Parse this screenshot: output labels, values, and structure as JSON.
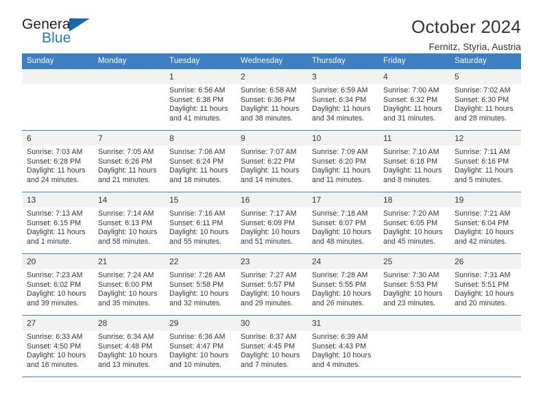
{
  "brand": {
    "word_one": "General",
    "word_two": "Blue",
    "flag_icon": "triangle-flag-icon"
  },
  "header": {
    "title": "October 2024",
    "location": "Fernitz, Styria, Austria"
  },
  "colors": {
    "header_blue": "#3d7fc1",
    "brand_blue": "#1f77bf",
    "daynum_band": "#f2f2f2",
    "text": "#333333"
  },
  "weekday_headers": [
    "Sunday",
    "Monday",
    "Tuesday",
    "Wednesday",
    "Thursday",
    "Friday",
    "Saturday"
  ],
  "weeks": [
    [
      {
        "day": "",
        "empty": true
      },
      {
        "day": "",
        "empty": true
      },
      {
        "day": "1",
        "sunrise": "Sunrise: 6:56 AM",
        "sunset": "Sunset: 6:38 PM",
        "daylight1": "Daylight: 11 hours",
        "daylight2": "and 41 minutes."
      },
      {
        "day": "2",
        "sunrise": "Sunrise: 6:58 AM",
        "sunset": "Sunset: 6:36 PM",
        "daylight1": "Daylight: 11 hours",
        "daylight2": "and 38 minutes."
      },
      {
        "day": "3",
        "sunrise": "Sunrise: 6:59 AM",
        "sunset": "Sunset: 6:34 PM",
        "daylight1": "Daylight: 11 hours",
        "daylight2": "and 34 minutes."
      },
      {
        "day": "4",
        "sunrise": "Sunrise: 7:00 AM",
        "sunset": "Sunset: 6:32 PM",
        "daylight1": "Daylight: 11 hours",
        "daylight2": "and 31 minutes."
      },
      {
        "day": "5",
        "sunrise": "Sunrise: 7:02 AM",
        "sunset": "Sunset: 6:30 PM",
        "daylight1": "Daylight: 11 hours",
        "daylight2": "and 28 minutes."
      }
    ],
    [
      {
        "day": "6",
        "sunrise": "Sunrise: 7:03 AM",
        "sunset": "Sunset: 6:28 PM",
        "daylight1": "Daylight: 11 hours",
        "daylight2": "and 24 minutes."
      },
      {
        "day": "7",
        "sunrise": "Sunrise: 7:05 AM",
        "sunset": "Sunset: 6:26 PM",
        "daylight1": "Daylight: 11 hours",
        "daylight2": "and 21 minutes."
      },
      {
        "day": "8",
        "sunrise": "Sunrise: 7:06 AM",
        "sunset": "Sunset: 6:24 PM",
        "daylight1": "Daylight: 11 hours",
        "daylight2": "and 18 minutes."
      },
      {
        "day": "9",
        "sunrise": "Sunrise: 7:07 AM",
        "sunset": "Sunset: 6:22 PM",
        "daylight1": "Daylight: 11 hours",
        "daylight2": "and 14 minutes."
      },
      {
        "day": "10",
        "sunrise": "Sunrise: 7:09 AM",
        "sunset": "Sunset: 6:20 PM",
        "daylight1": "Daylight: 11 hours",
        "daylight2": "and 11 minutes."
      },
      {
        "day": "11",
        "sunrise": "Sunrise: 7:10 AM",
        "sunset": "Sunset: 6:18 PM",
        "daylight1": "Daylight: 11 hours",
        "daylight2": "and 8 minutes."
      },
      {
        "day": "12",
        "sunrise": "Sunrise: 7:11 AM",
        "sunset": "Sunset: 6:16 PM",
        "daylight1": "Daylight: 11 hours",
        "daylight2": "and 5 minutes."
      }
    ],
    [
      {
        "day": "13",
        "sunrise": "Sunrise: 7:13 AM",
        "sunset": "Sunset: 6:15 PM",
        "daylight1": "Daylight: 11 hours",
        "daylight2": "and 1 minute."
      },
      {
        "day": "14",
        "sunrise": "Sunrise: 7:14 AM",
        "sunset": "Sunset: 6:13 PM",
        "daylight1": "Daylight: 10 hours",
        "daylight2": "and 58 minutes."
      },
      {
        "day": "15",
        "sunrise": "Sunrise: 7:16 AM",
        "sunset": "Sunset: 6:11 PM",
        "daylight1": "Daylight: 10 hours",
        "daylight2": "and 55 minutes."
      },
      {
        "day": "16",
        "sunrise": "Sunrise: 7:17 AM",
        "sunset": "Sunset: 6:09 PM",
        "daylight1": "Daylight: 10 hours",
        "daylight2": "and 51 minutes."
      },
      {
        "day": "17",
        "sunrise": "Sunrise: 7:18 AM",
        "sunset": "Sunset: 6:07 PM",
        "daylight1": "Daylight: 10 hours",
        "daylight2": "and 48 minutes."
      },
      {
        "day": "18",
        "sunrise": "Sunrise: 7:20 AM",
        "sunset": "Sunset: 6:05 PM",
        "daylight1": "Daylight: 10 hours",
        "daylight2": "and 45 minutes."
      },
      {
        "day": "19",
        "sunrise": "Sunrise: 7:21 AM",
        "sunset": "Sunset: 6:04 PM",
        "daylight1": "Daylight: 10 hours",
        "daylight2": "and 42 minutes."
      }
    ],
    [
      {
        "day": "20",
        "sunrise": "Sunrise: 7:23 AM",
        "sunset": "Sunset: 6:02 PM",
        "daylight1": "Daylight: 10 hours",
        "daylight2": "and 39 minutes."
      },
      {
        "day": "21",
        "sunrise": "Sunrise: 7:24 AM",
        "sunset": "Sunset: 6:00 PM",
        "daylight1": "Daylight: 10 hours",
        "daylight2": "and 35 minutes."
      },
      {
        "day": "22",
        "sunrise": "Sunrise: 7:26 AM",
        "sunset": "Sunset: 5:58 PM",
        "daylight1": "Daylight: 10 hours",
        "daylight2": "and 32 minutes."
      },
      {
        "day": "23",
        "sunrise": "Sunrise: 7:27 AM",
        "sunset": "Sunset: 5:57 PM",
        "daylight1": "Daylight: 10 hours",
        "daylight2": "and 29 minutes."
      },
      {
        "day": "24",
        "sunrise": "Sunrise: 7:28 AM",
        "sunset": "Sunset: 5:55 PM",
        "daylight1": "Daylight: 10 hours",
        "daylight2": "and 26 minutes."
      },
      {
        "day": "25",
        "sunrise": "Sunrise: 7:30 AM",
        "sunset": "Sunset: 5:53 PM",
        "daylight1": "Daylight: 10 hours",
        "daylight2": "and 23 minutes."
      },
      {
        "day": "26",
        "sunrise": "Sunrise: 7:31 AM",
        "sunset": "Sunset: 5:51 PM",
        "daylight1": "Daylight: 10 hours",
        "daylight2": "and 20 minutes."
      }
    ],
    [
      {
        "day": "27",
        "sunrise": "Sunrise: 6:33 AM",
        "sunset": "Sunset: 4:50 PM",
        "daylight1": "Daylight: 10 hours",
        "daylight2": "and 16 minutes."
      },
      {
        "day": "28",
        "sunrise": "Sunrise: 6:34 AM",
        "sunset": "Sunset: 4:48 PM",
        "daylight1": "Daylight: 10 hours",
        "daylight2": "and 13 minutes."
      },
      {
        "day": "29",
        "sunrise": "Sunrise: 6:36 AM",
        "sunset": "Sunset: 4:47 PM",
        "daylight1": "Daylight: 10 hours",
        "daylight2": "and 10 minutes."
      },
      {
        "day": "30",
        "sunrise": "Sunrise: 6:37 AM",
        "sunset": "Sunset: 4:45 PM",
        "daylight1": "Daylight: 10 hours",
        "daylight2": "and 7 minutes."
      },
      {
        "day": "31",
        "sunrise": "Sunrise: 6:39 AM",
        "sunset": "Sunset: 4:43 PM",
        "daylight1": "Daylight: 10 hours",
        "daylight2": "and 4 minutes."
      },
      {
        "day": "",
        "empty": true
      },
      {
        "day": "",
        "empty": true
      }
    ]
  ]
}
